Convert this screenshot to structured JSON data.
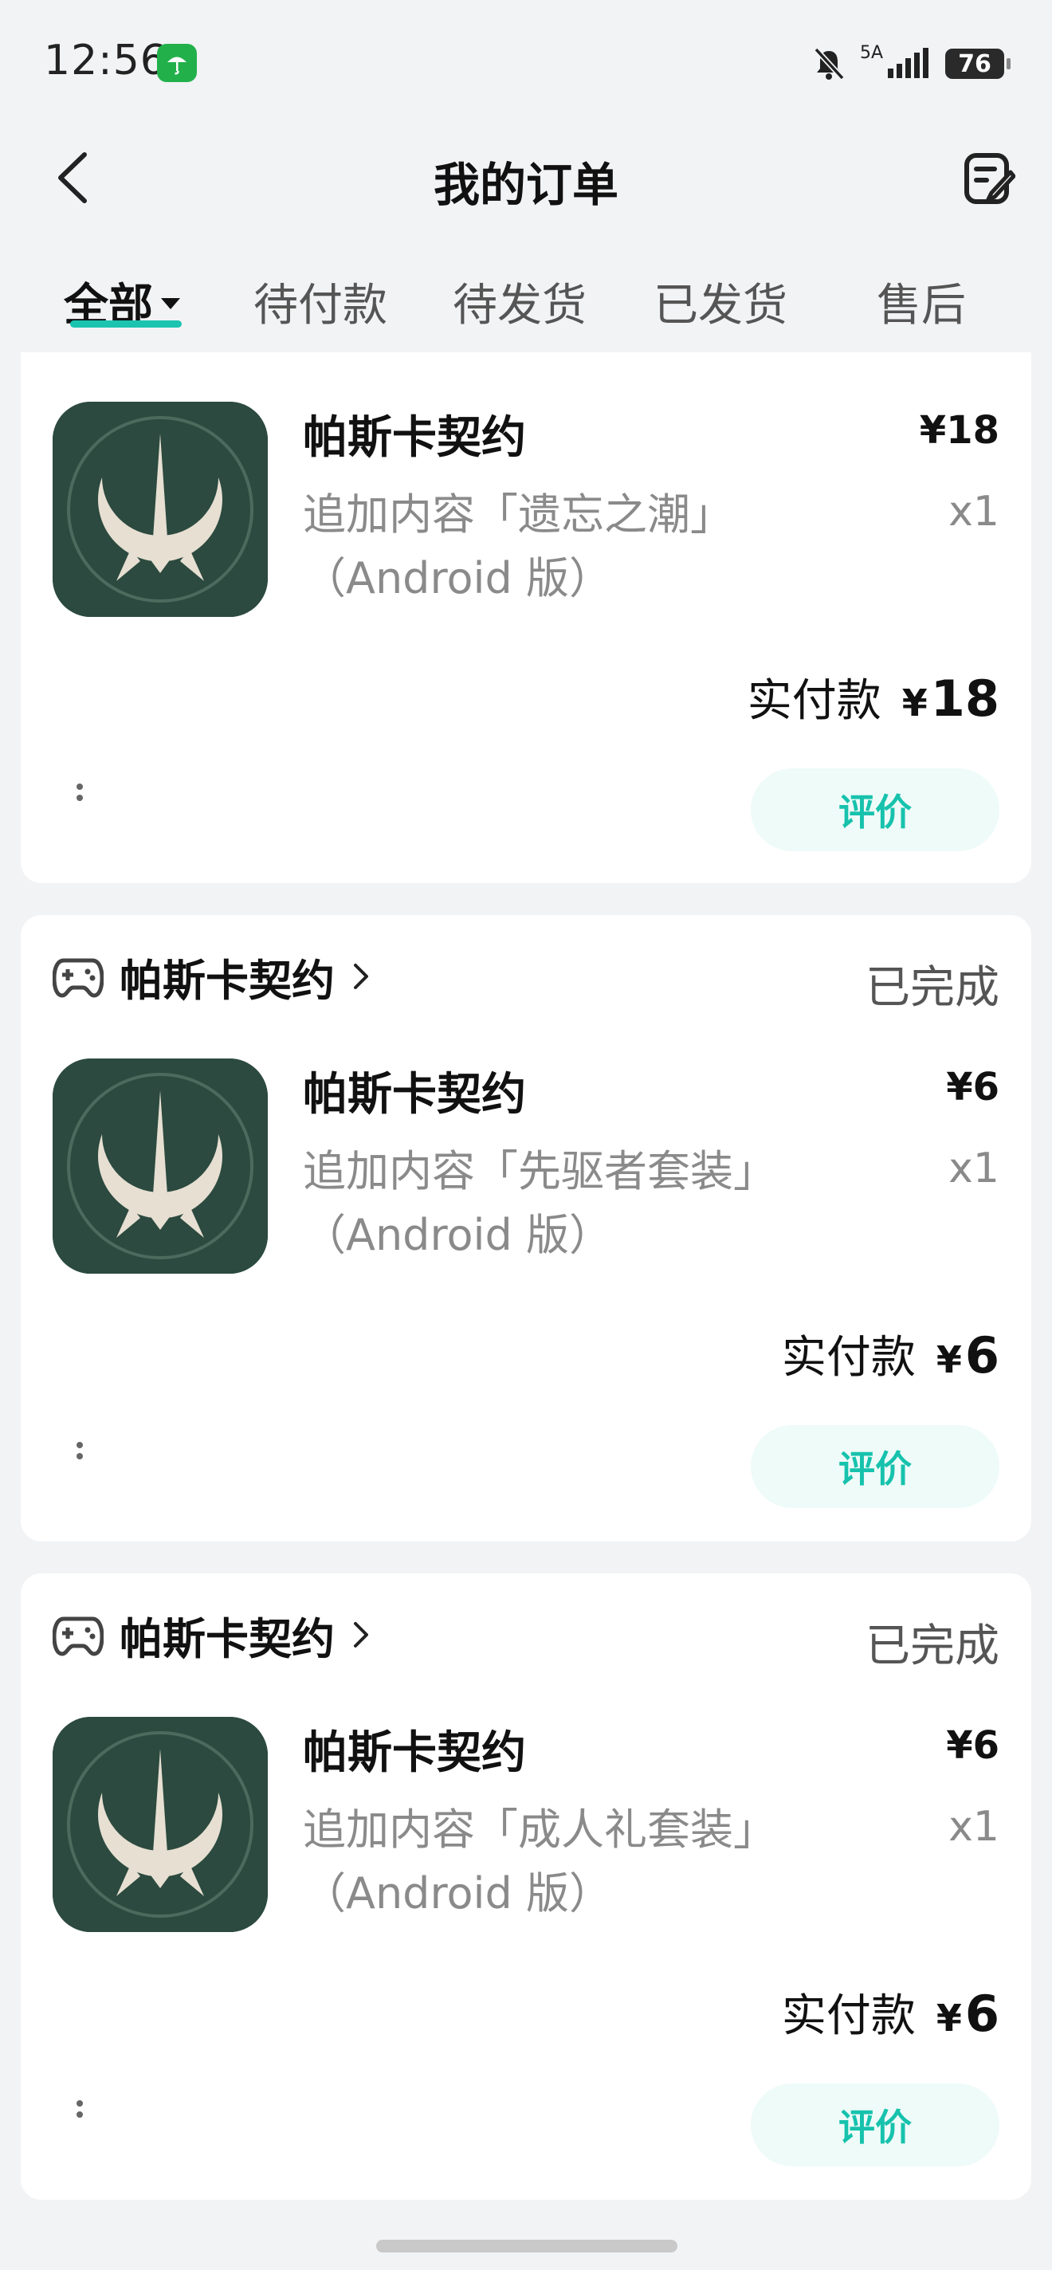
{
  "status_bar": {
    "time": "12:56",
    "network": "5A",
    "battery": "76"
  },
  "header": {
    "title": "我的订单"
  },
  "tabs": [
    {
      "label": "全部",
      "active": true
    },
    {
      "label": "待付款"
    },
    {
      "label": "待发货"
    },
    {
      "label": "已发货"
    },
    {
      "label": "售后"
    }
  ],
  "orders": [
    {
      "product_title": "帕斯卡契约",
      "description": "追加内容「遗忘之潮」（Android 版）",
      "price": "¥18",
      "quantity": "x1",
      "paid_label": "实付款",
      "paid_currency": "¥",
      "paid_amount": "18",
      "action": "评价"
    },
    {
      "game_name": "帕斯卡契约",
      "status": "已完成",
      "product_title": "帕斯卡契约",
      "description": "追加内容「先驱者套装」（Android 版）",
      "price": "¥6",
      "quantity": "x1",
      "paid_label": "实付款",
      "paid_currency": "¥",
      "paid_amount": "6",
      "action": "评价"
    },
    {
      "game_name": "帕斯卡契约",
      "status": "已完成",
      "product_title": "帕斯卡契约",
      "description": "追加内容「成人礼套装」（Android 版）",
      "price": "¥6",
      "quantity": "x1",
      "paid_label": "实付款",
      "paid_currency": "¥",
      "paid_amount": "6",
      "action": "评价"
    }
  ],
  "colors": {
    "accent": "#1bc4b0",
    "review_bg": "#eefbf8",
    "page_bg": "#f2f3f5",
    "icon_bg": "#2c4a3f"
  }
}
